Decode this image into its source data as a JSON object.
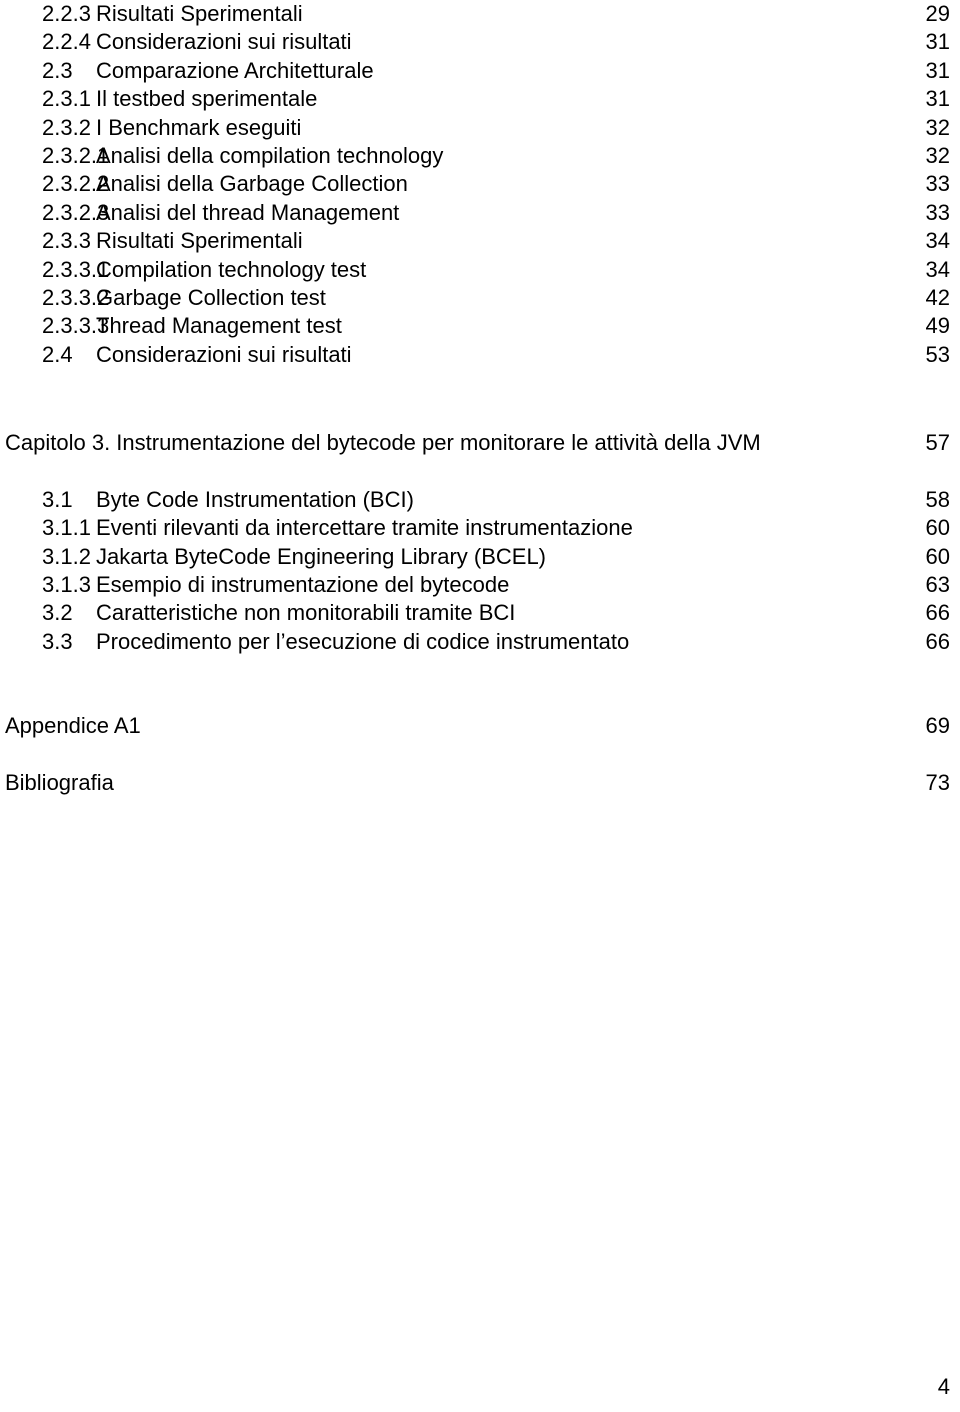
{
  "document": {
    "kind": "table-of-contents",
    "language": "it",
    "folio": "4"
  },
  "toc": {
    "group_chapter2": [
      {
        "number": "2.2.3",
        "title": "Risultati Sperimentali",
        "page": "29"
      },
      {
        "number": "2.2.4",
        "title": "Considerazioni sui risultati",
        "page": "31"
      },
      {
        "number": "2.3",
        "title": "Comparazione Architetturale",
        "page": "31"
      },
      {
        "number": "2.3.1",
        "title": "Il testbed sperimentale",
        "page": "31"
      },
      {
        "number": "2.3.2",
        "title": "I Benchmark eseguiti",
        "page": "32"
      },
      {
        "number": "2.3.2.1",
        "title": "Analisi della compilation technology",
        "page": "32"
      },
      {
        "number": "2.3.2.2",
        "title": "Analisi della Garbage Collection",
        "page": "33"
      },
      {
        "number": "2.3.2.3",
        "title": "Analisi del thread Management",
        "page": "33"
      },
      {
        "number": "2.3.3",
        "title": "Risultati Sperimentali",
        "page": "34"
      },
      {
        "number": "2.3.3.1",
        "title": "Compilation technology test",
        "page": "34"
      },
      {
        "number": "2.3.3.2",
        "title": "Garbage Collection test",
        "page": "42"
      },
      {
        "number": "2.3.3.3",
        "title": "Thread Management test",
        "page": "49"
      },
      {
        "number": "2.4",
        "title": "Considerazioni sui risultati",
        "page": "53"
      }
    ],
    "chapter3": {
      "title": "Capitolo 3. Instrumentazione del bytecode per monitorare le attività della JVM",
      "page": "57"
    },
    "group_chapter3": [
      {
        "number": "3.1",
        "title": "Byte Code Instrumentation (BCI)",
        "page": "58"
      },
      {
        "number": "3.1.1",
        "title": "Eventi rilevanti da intercettare tramite instrumentazione",
        "page": "60"
      },
      {
        "number": "3.1.2",
        "title": "Jakarta ByteCode Engineering Library (BCEL)",
        "page": "60"
      },
      {
        "number": "3.1.3",
        "title": "Esempio di instrumentazione del bytecode",
        "page": "63"
      },
      {
        "number": "3.2",
        "title": "Caratteristiche non monitorabili tramite BCI",
        "page": "66"
      },
      {
        "number": "3.3",
        "title": "Procedimento per l’esecuzione di codice instrumentato",
        "page": "66"
      }
    ],
    "appendix": {
      "title": "Appendice A1",
      "page": "69"
    },
    "bibliography": {
      "title": "Bibliografia",
      "page": "73"
    }
  }
}
